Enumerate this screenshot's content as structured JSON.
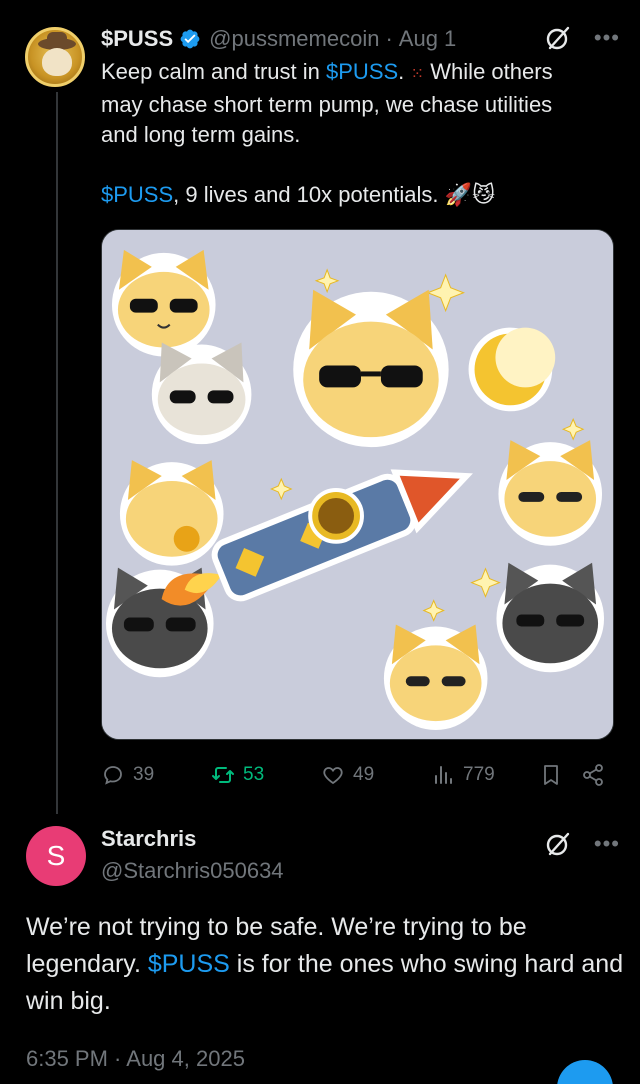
{
  "tweet": {
    "author_name": "$PUSS",
    "handle": "@pussmemecoin",
    "separator": "·",
    "date": "Aug 1",
    "text_line1_prefix": "Keep calm and trust in ",
    "cashtag": "$PUSS",
    "text_line1_suffix": ".",
    "text_line1_after_paw": "While others",
    "text_line2": "may chase short term pump, we chase utilities",
    "text_line3": "and long term gains.",
    "text_line4_suffix": ", 9 lives and 10x potentials.",
    "metrics": {
      "replies": "39",
      "reposts": "53",
      "likes": "49",
      "views": "779"
    }
  },
  "reply": {
    "avatar_letter": "S",
    "author_name": "Starchris",
    "handle": "@Starchris050634",
    "text_part1": "We’re not trying to be safe. We’re trying to be legendary. ",
    "cashtag": "$PUSS",
    "text_part2": " is for the ones who swing hard and win big.",
    "timestamp": "6:35 PM · Aug 4, 2025"
  },
  "colors": {
    "background": "#000000",
    "text": "#e7e9ea",
    "muted": "#71767b",
    "link": "#1d9bf0",
    "repost_active": "#00ba7c",
    "reply_avatar": "#e83c75"
  },
  "icons": [
    "verified-badge-icon",
    "grok-icon",
    "more-icon",
    "reply-icon",
    "repost-icon",
    "like-icon",
    "views-icon",
    "bookmark-icon",
    "share-icon",
    "paw-icon",
    "rocket-emoji",
    "cat-emoji"
  ]
}
